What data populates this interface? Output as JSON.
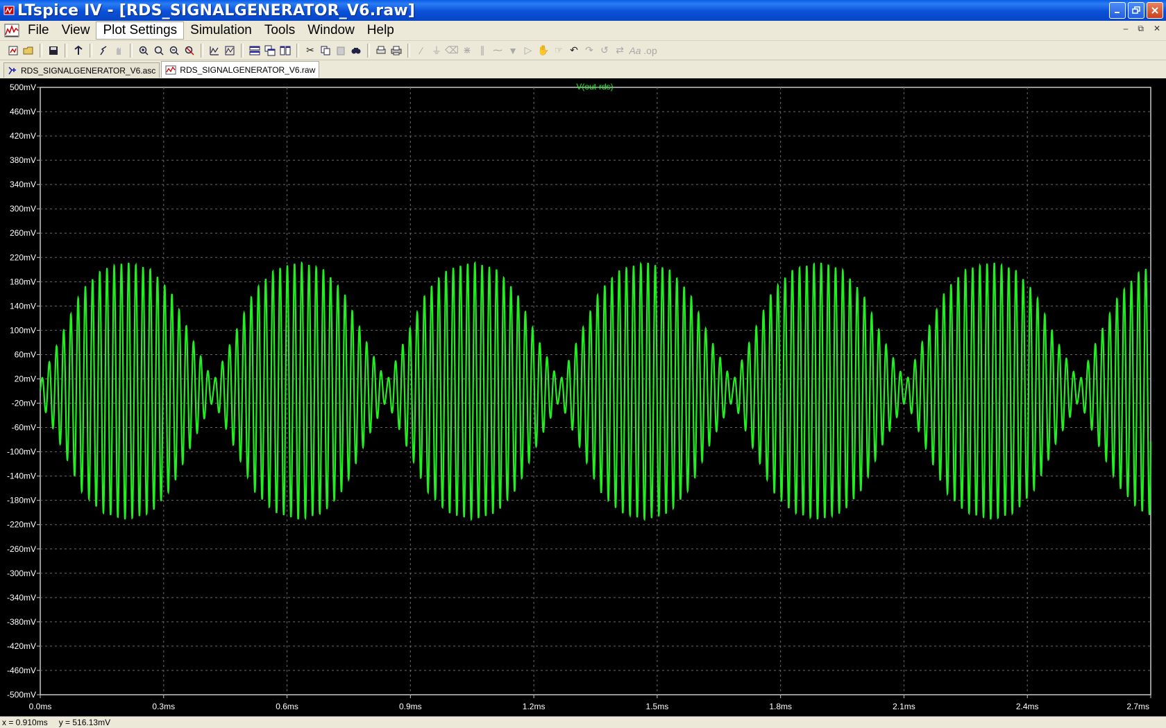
{
  "window": {
    "title": "LTspice IV - [RDS_SIGNALGENERATOR_V6.raw]",
    "buttons": [
      "minimize",
      "restore",
      "close"
    ]
  },
  "menu": {
    "items": [
      "File",
      "View",
      "Plot Settings",
      "Simulation",
      "Tools",
      "Window",
      "Help"
    ],
    "active": "Plot Settings"
  },
  "toolbar": {
    "icons": [
      "new-schematic-icon",
      "open-icon",
      "save-icon",
      "control-panel-icon",
      "run-icon",
      "halt-icon",
      "zoom-in-icon",
      "zoom-pan-icon",
      "zoom-out-icon",
      "zoom-fit-icon",
      "autorange-icon",
      "manual-limits-icon",
      "tile-horizontal-icon",
      "cascade-icon",
      "tile-vertical-icon",
      "cut-icon",
      "copy-icon",
      "paste-icon",
      "find-icon",
      "print-preview-icon",
      "print-icon",
      "wire-icon",
      "ground-icon",
      "label-icon",
      "resistor-icon",
      "capacitor-icon",
      "inductor-icon",
      "diode-icon",
      "component-icon",
      "move-icon",
      "drag-icon",
      "undo-icon",
      "redo-icon",
      "rotate-icon",
      "mirror-icon",
      "text-icon",
      "spice-directive-icon"
    ]
  },
  "tabs": [
    {
      "label": "RDS_SIGNALGENERATOR_V6.asc",
      "icon": "schematic-icon",
      "active": false
    },
    {
      "label": "RDS_SIGNALGENERATOR_V6.raw",
      "icon": "waveform-icon",
      "active": true
    }
  ],
  "colors": {
    "trace": "#22ee22",
    "background": "#000000",
    "grid": "#6a6a6a",
    "axis_text": "#ffffff"
  },
  "chart_data": {
    "type": "line",
    "title": "V(out-rds)",
    "xlabel": "",
    "ylabel": "",
    "xlim": [
      0,
      2.7
    ],
    "ylim": [
      -500,
      500
    ],
    "x_unit": "ms",
    "y_unit": "mV",
    "grid": true,
    "x_ticks": [
      "0.0ms",
      "0.3ms",
      "0.6ms",
      "0.9ms",
      "1.2ms",
      "1.5ms",
      "1.8ms",
      "2.1ms",
      "2.4ms",
      "2.7ms"
    ],
    "y_ticks": [
      "500mV",
      "460mV",
      "420mV",
      "380mV",
      "340mV",
      "300mV",
      "260mV",
      "220mV",
      "180mV",
      "140mV",
      "100mV",
      "60mV",
      "20mV",
      "-20mV",
      "-60mV",
      "-100mV",
      "-140mV",
      "-180mV",
      "-220mV",
      "-260mV",
      "-300mV",
      "-340mV",
      "-380mV",
      "-420mV",
      "-460mV",
      "-500mV"
    ],
    "series": [
      {
        "name": "V(out-rds)",
        "description_points": {
          "carrier_period_ms": 0.01754,
          "envelope_period_ms": 0.421,
          "peak_amplitude_mV": 212,
          "envelope_min_at_ms": [
            0.0,
            0.421,
            0.842,
            1.263,
            1.684,
            2.105,
            2.526
          ],
          "envelope_max_at_ms": [
            0.21,
            0.631,
            1.052,
            1.473,
            1.894,
            2.315
          ]
        },
        "envelope_x": [
          0.0,
          0.05,
          0.1,
          0.15,
          0.21,
          0.27,
          0.32,
          0.37,
          0.421,
          0.47,
          0.52,
          0.57,
          0.631,
          0.69,
          0.74,
          0.79,
          0.842,
          0.89,
          0.94,
          0.99,
          1.052,
          1.11,
          1.16,
          1.21,
          1.263,
          1.31,
          1.36,
          1.41,
          1.473,
          1.53,
          1.58,
          1.63,
          1.684,
          1.73,
          1.78,
          1.83,
          1.894,
          1.95,
          2.0,
          2.05,
          2.105,
          2.15,
          2.2,
          2.25,
          2.315,
          2.37,
          2.42,
          2.47,
          2.526,
          2.57,
          2.62,
          2.67,
          2.7
        ],
        "envelope_y": [
          15,
          90,
          165,
          200,
          212,
          200,
          160,
          85,
          15,
          90,
          165,
          200,
          212,
          200,
          160,
          85,
          15,
          90,
          165,
          200,
          212,
          200,
          160,
          85,
          15,
          90,
          165,
          200,
          212,
          200,
          160,
          85,
          15,
          90,
          165,
          200,
          212,
          200,
          160,
          85,
          15,
          90,
          165,
          200,
          212,
          200,
          160,
          85,
          15,
          85,
          155,
          195,
          205
        ]
      }
    ]
  },
  "status": {
    "x_readout": "x = 0.910ms",
    "y_readout": "y = 516.13mV"
  }
}
